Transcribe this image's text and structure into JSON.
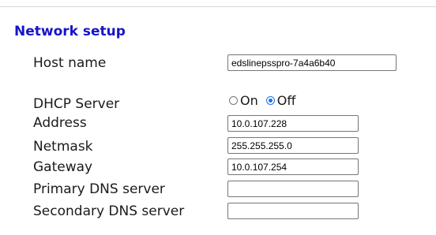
{
  "section_title": "Network setup",
  "fields": {
    "host_name": {
      "label": "Host name",
      "value": "edslinepsspro-7a4a6b40"
    },
    "dhcp_server": {
      "label": "DHCP Server",
      "options": [
        "On",
        "Off"
      ],
      "selected": "Off"
    },
    "address": {
      "label": "Address",
      "value": "10.0.107.228"
    },
    "netmask": {
      "label": "Netmask",
      "value": "255.255.255.0"
    },
    "gateway": {
      "label": "Gateway",
      "value": "10.0.107.254"
    },
    "primary_dns": {
      "label": "Primary DNS server",
      "value": ""
    },
    "secondary_dns": {
      "label": "Secondary DNS server",
      "value": ""
    }
  },
  "colors": {
    "section_title": "#1515c8",
    "radio_selected": "#1a73e8"
  }
}
